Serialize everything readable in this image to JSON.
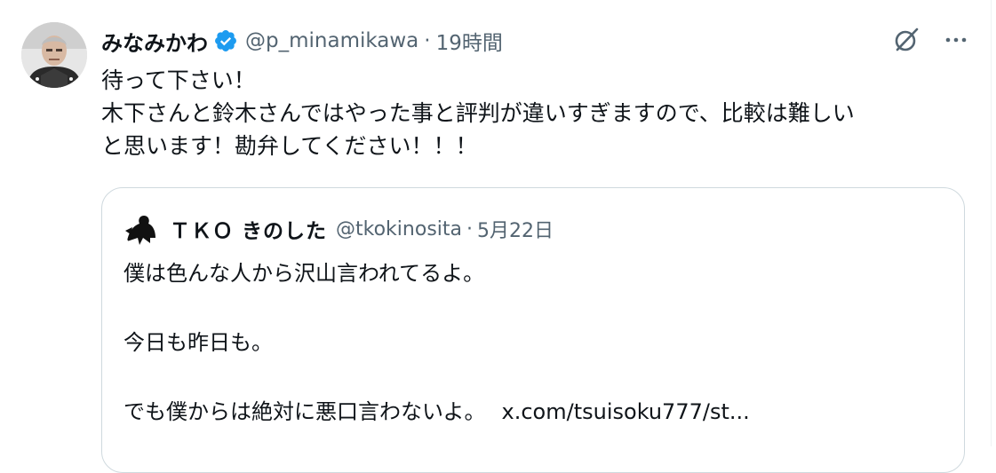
{
  "tweet": {
    "display_name": "みなみかわ",
    "handle": "@p_minamikawa",
    "separator": "·",
    "time": "19時間",
    "text_lines": [
      "待って下さい！",
      "木下さんと鈴木さんではやった事と評判が違いすぎますので、比較は難しい",
      "と思います！勘弁してください！！！"
    ]
  },
  "quote": {
    "display_name": "ＴＫＯ きのした",
    "handle": "@tkokinosita",
    "separator": "·",
    "date": "5月22日",
    "lines": [
      "僕は色んな人から沢山言われてるよ。",
      "今日も昨日も。",
      "でも僕からは絶対に悪口言わないよ。"
    ],
    "link": "x.com/tsuisoku777/st..."
  },
  "icons": {
    "verified": "verified-badge-icon",
    "grok": "grok-icon",
    "more": "more-icon"
  },
  "colors": {
    "verified": "#1d9bf0",
    "secondary_text": "#536471",
    "primary_text": "#0f1419",
    "border": "#cfd9de"
  }
}
